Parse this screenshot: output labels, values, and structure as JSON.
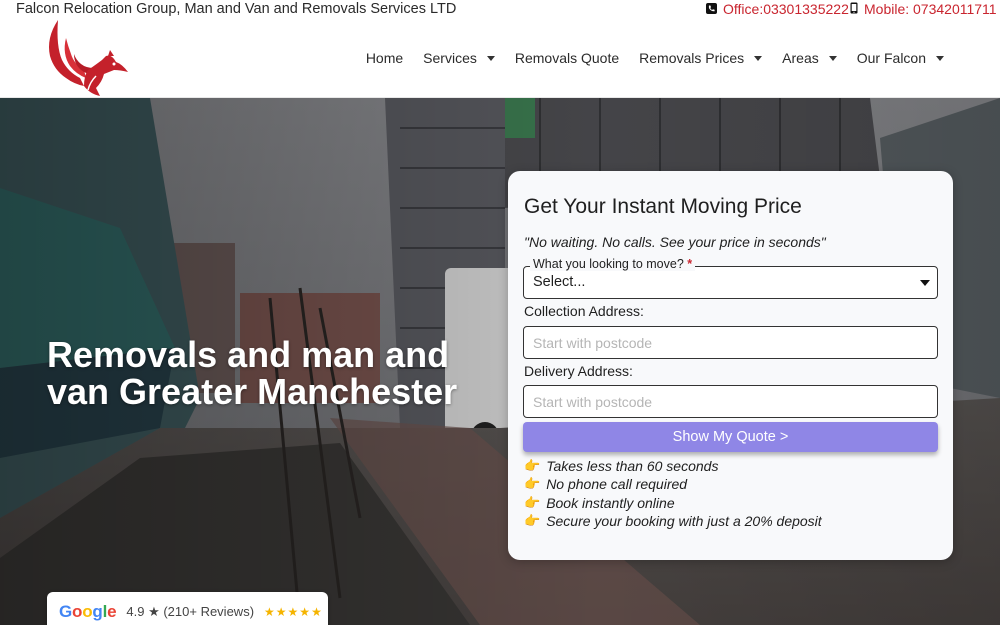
{
  "topbar": {
    "company_name": "Falcon Relocation Group, Man and Van and Removals Services LTD",
    "office_phone": "Office:03301335222",
    "mobile_phone": "Mobile: 07342011711",
    "office_icon": "phone-square-icon",
    "mobile_icon": "mobile-phone-icon",
    "accent_color": "#c9252f"
  },
  "header": {
    "logo_icon": "falcon-logo-icon",
    "nav": [
      {
        "label": "Home",
        "has_dropdown": false
      },
      {
        "label": "Services",
        "has_dropdown": true
      },
      {
        "label": "Removals Quote",
        "has_dropdown": false
      },
      {
        "label": "Removals Prices",
        "has_dropdown": true
      },
      {
        "label": "Areas",
        "has_dropdown": true
      },
      {
        "label": "Our Falcon",
        "has_dropdown": true
      }
    ]
  },
  "hero": {
    "title": "Removals and man and van Greater Manchester"
  },
  "google_badge": {
    "rating_text": "4.9 ★ (210+ Reviews)",
    "stars": "★★★★★",
    "rating": 4.9
  },
  "quote_card": {
    "title": "Get Your Instant Moving Price",
    "subtitle": "\"No waiting. No calls. See your price in seconds\"",
    "move_select": {
      "label": "What you looking to move?",
      "required_marker": "*",
      "value": "Select..."
    },
    "collection": {
      "label": "Collection Address:",
      "placeholder": "Start with postcode"
    },
    "delivery": {
      "label": "Delivery Address:",
      "placeholder": "Start with postcode"
    },
    "submit_label": "Show My Quote >",
    "submit_color": "#8f86e6",
    "benefit_icon": "pointing-hand-icon",
    "benefits": [
      "Takes less than 60 seconds",
      "No phone call required",
      "Book instantly online",
      "Secure your booking with just a 20% deposit"
    ]
  }
}
